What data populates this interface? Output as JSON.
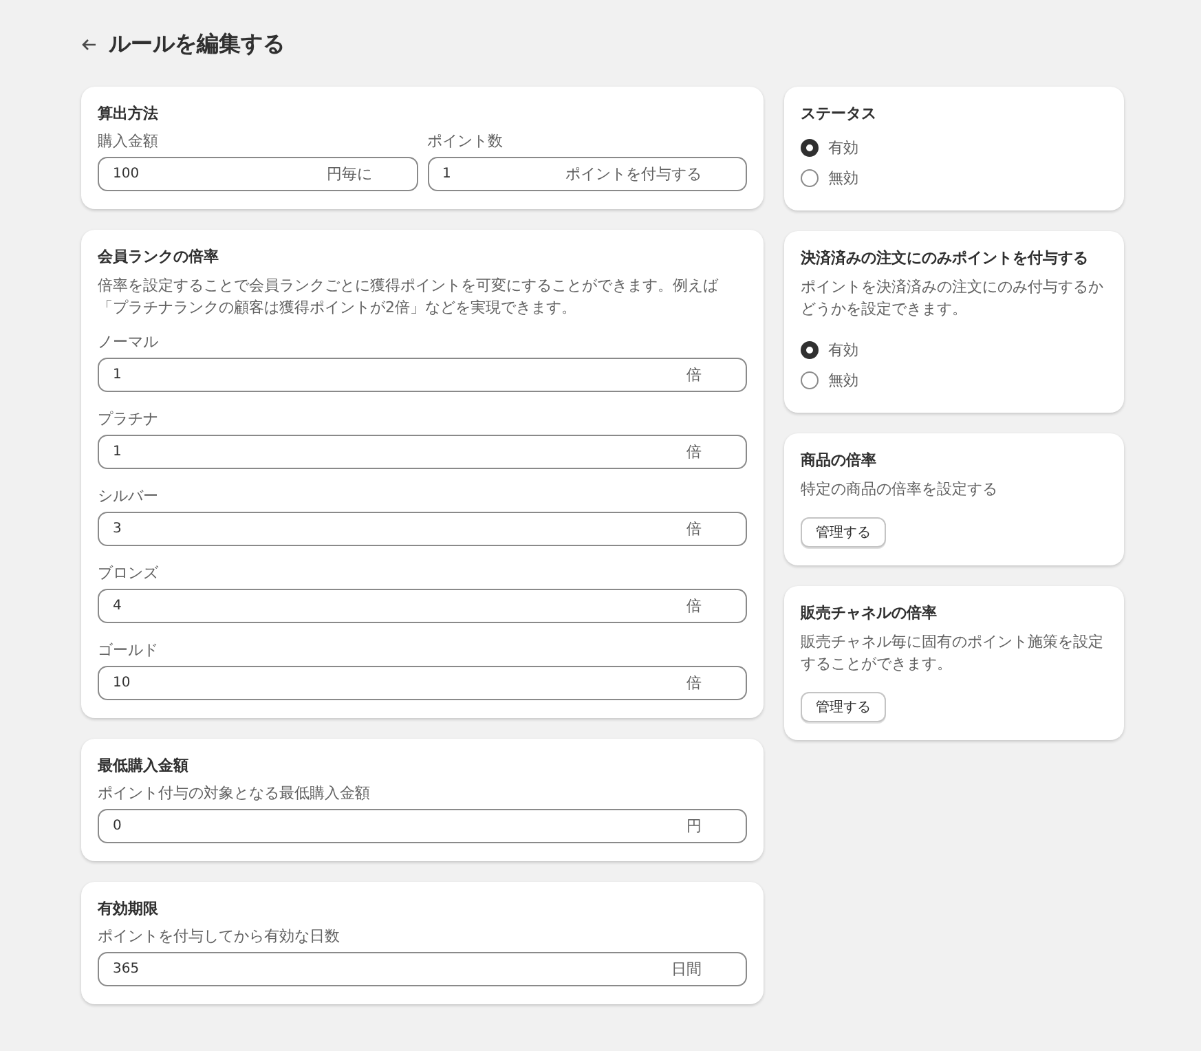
{
  "page": {
    "title": "ルールを編集する"
  },
  "main_column": [
    {
      "kind": "form_row",
      "title": "算出方法",
      "fields": [
        {
          "label": "購入金額",
          "value": "100",
          "suffix": "円毎に"
        },
        {
          "label": "ポイント数",
          "value": "1",
          "suffix": "ポイントを付与する"
        }
      ]
    },
    {
      "kind": "form",
      "title": "会員ランクの倍率",
      "description": "倍率を設定することで会員ランクごとに獲得ポイントを可変にすることができます。例えば「プラチナランクの顧客は獲得ポイントが2倍」などを実現できます。",
      "fields": [
        {
          "label": "ノーマル",
          "value": "1",
          "suffix": "倍"
        },
        {
          "label": "プラチナ",
          "value": "1",
          "suffix": "倍"
        },
        {
          "label": "シルバー",
          "value": "3",
          "suffix": "倍"
        },
        {
          "label": "ブロンズ",
          "value": "4",
          "suffix": "倍"
        },
        {
          "label": "ゴールド",
          "value": "10",
          "suffix": "倍"
        }
      ]
    },
    {
      "kind": "form",
      "title": "最低購入金額",
      "fields": [
        {
          "label": "ポイント付与の対象となる最低購入金額",
          "value": "0",
          "suffix": "円"
        }
      ]
    },
    {
      "kind": "form",
      "title": "有効期限",
      "fields": [
        {
          "label": "ポイントを付与してから有効な日数",
          "value": "365",
          "suffix": "日間"
        }
      ]
    }
  ],
  "side_column": [
    {
      "kind": "radio",
      "title": "ステータス",
      "options": [
        {
          "label": "有効",
          "selected": true
        },
        {
          "label": "無効",
          "selected": false
        }
      ]
    },
    {
      "kind": "radio",
      "title": "決済済みの注文にのみポイントを付与する",
      "description": "ポイントを決済済みの注文にのみ付与するかどうかを設定できます。",
      "options": [
        {
          "label": "有効",
          "selected": true
        },
        {
          "label": "無効",
          "selected": false
        }
      ]
    },
    {
      "kind": "action",
      "title": "商品の倍率",
      "description": "特定の商品の倍率を設定する",
      "button": "管理する"
    },
    {
      "kind": "action",
      "title": "販売チャネルの倍率",
      "description": "販売チャネル毎に固有のポイント施策を設定することができます。",
      "button": "管理する"
    }
  ]
}
